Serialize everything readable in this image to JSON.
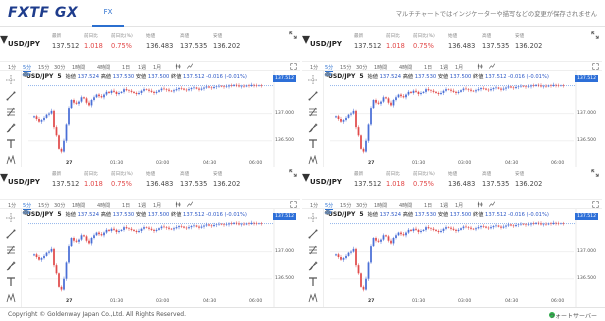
{
  "header": {
    "logo": "FXTF GX",
    "tab_fx": "FX",
    "notice": "マルチチャートではインジケーターや描写などの変更が保存されません"
  },
  "colors": {
    "up": "#4a6fd6",
    "down": "#e14b4b",
    "price_line": "#2d6fd8",
    "up_text_red": "#e14444",
    "status_green": "#2db84c"
  },
  "quote_labels": [
    "最新",
    "前日比",
    "前日比(%)",
    "始値",
    "高値",
    "安値"
  ],
  "timeframes": [
    "1分",
    "5分",
    "15分",
    "30分",
    "1時間",
    "4時間",
    "1日",
    "1週",
    "1月"
  ],
  "active_timeframe": "5分",
  "panes": [
    {
      "symbol": "USD/JPY",
      "quote": {
        "last": "137.512",
        "change": "1.018",
        "change_pct": "0.75%",
        "open": "136.483",
        "high": "137.535",
        "low": "136.202"
      },
      "chart_title": {
        "symbol": "USD/JPY",
        "interval": "5",
        "open_label": "始値",
        "open": "137.524",
        "high_label": "高値",
        "high": "137.530",
        "low_label": "安値",
        "low": "137.500",
        "close_label": "終値",
        "close": "137.512",
        "change": "-0.016 (-0.01%)"
      },
      "price_tag": "137.512",
      "y_ticks": [
        "137.000",
        "136.500"
      ],
      "x_ticks": [
        "27",
        "01:30",
        "03:00",
        "04:30",
        "06:00"
      ]
    },
    {
      "symbol": "USD/JPY",
      "quote": {
        "last": "137.512",
        "change": "1.018",
        "change_pct": "0.75%",
        "open": "136.483",
        "high": "137.535",
        "low": "136.202"
      },
      "chart_title": {
        "symbol": "USD/JPY",
        "interval": "5",
        "open_label": "始値",
        "open": "137.524",
        "high_label": "高値",
        "high": "137.530",
        "low_label": "安値",
        "low": "137.500",
        "close_label": "終値",
        "close": "137.512",
        "change": "-0.016 (-0.01%)"
      },
      "price_tag": "137.512",
      "y_ticks": [
        "137.000",
        "136.500"
      ],
      "x_ticks": [
        "27",
        "01:30",
        "03:00",
        "04:30",
        "06:00"
      ]
    },
    {
      "symbol": "USD/JPY",
      "quote": {
        "last": "137.512",
        "change": "1.018",
        "change_pct": "0.75%",
        "open": "136.483",
        "high": "137.535",
        "low": "136.202"
      },
      "chart_title": {
        "symbol": "USD/JPY",
        "interval": "5",
        "open_label": "始値",
        "open": "137.524",
        "high_label": "高値",
        "high": "137.530",
        "low_label": "安値",
        "low": "137.500",
        "close_label": "終値",
        "close": "137.512",
        "change": "-0.016 (-0.01%)"
      },
      "price_tag": "137.512",
      "y_ticks": [
        "137.000",
        "136.500"
      ],
      "x_ticks": [
        "27",
        "01:30",
        "03:00",
        "04:30",
        "06:00"
      ]
    },
    {
      "symbol": "USD/JPY",
      "quote": {
        "last": "137.512",
        "change": "1.018",
        "change_pct": "0.75%",
        "open": "136.483",
        "high": "137.535",
        "low": "136.202"
      },
      "chart_title": {
        "symbol": "USD/JPY",
        "interval": "5",
        "open_label": "始値",
        "open": "137.524",
        "high_label": "高値",
        "high": "137.530",
        "low_label": "安値",
        "low": "137.500",
        "close_label": "終値",
        "close": "137.512",
        "change": "-0.016 (-0.01%)"
      },
      "price_tag": "137.512",
      "y_ticks": [
        "137.000",
        "136.500"
      ],
      "x_ticks": [
        "27",
        "01:30",
        "03:00",
        "04:30",
        "06:00"
      ]
    }
  ],
  "chart_data": {
    "type": "candlestick",
    "series_count": 4,
    "ylim": [
      136.2,
      137.6
    ],
    "x_ticks": [
      "27",
      "01:30",
      "03:00",
      "04:30",
      "06:00"
    ],
    "closes": [
      136.95,
      136.9,
      136.85,
      136.88,
      136.92,
      136.98,
      137.0,
      137.05,
      136.75,
      136.6,
      136.35,
      136.3,
      136.5,
      136.8,
      137.1,
      137.25,
      137.2,
      137.18,
      137.22,
      137.3,
      137.28,
      137.2,
      137.15,
      137.25,
      137.3,
      137.35,
      137.32,
      137.3,
      137.35,
      137.4,
      137.38,
      137.42,
      137.4,
      137.36,
      137.38,
      137.4,
      137.45,
      137.43,
      137.42,
      137.4,
      137.38,
      137.36,
      137.38,
      137.42,
      137.45,
      137.44,
      137.42,
      137.4,
      137.38,
      137.4,
      137.43,
      137.46,
      137.45,
      137.44,
      137.42,
      137.41,
      137.43,
      137.45,
      137.47,
      137.46,
      137.44,
      137.43,
      137.45,
      137.47,
      137.48,
      137.46,
      137.44,
      137.46,
      137.48,
      137.5,
      137.48,
      137.47,
      137.49,
      137.5,
      137.51,
      137.5,
      137.49,
      137.5,
      137.52,
      137.51,
      137.53,
      137.52,
      137.5,
      137.51,
      137.5,
      137.52,
      137.51,
      137.53,
      137.52,
      137.51,
      137.52,
      137.512
    ]
  },
  "footer": {
    "copyright": "Copyright © Goldenway Japan Co.,Ltd. All Rights Reserved.",
    "server": "ウォートサーバー"
  }
}
